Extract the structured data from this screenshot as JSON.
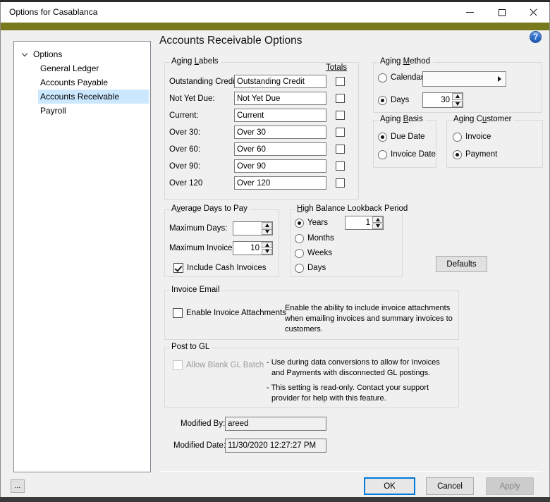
{
  "window": {
    "title": "Options for Casablanca"
  },
  "colors": {
    "accent_bar": "#79791e",
    "tree_selection": "#cce8ff",
    "default_button_border": "#0078d7",
    "help_blue": "#2e71d2"
  },
  "help_icon_glyph": "?",
  "sidebar": {
    "root": "Options",
    "items": [
      {
        "label": "General Ledger",
        "selected": false
      },
      {
        "label": "Accounts Payable",
        "selected": false
      },
      {
        "label": "Accounts Receivable",
        "selected": true
      },
      {
        "label": "Payroll",
        "selected": false
      }
    ]
  },
  "page": {
    "title": "Accounts Receivable Options"
  },
  "aging_labels": {
    "title": {
      "pre": "Aging ",
      "mn": "L",
      "post": "abels"
    },
    "totals_header": "Totals",
    "rows": [
      {
        "label": "Outstanding Credit:",
        "value": "Outstanding Credit",
        "totals_checked": false
      },
      {
        "label": "Not Yet Due:",
        "value": "Not Yet Due",
        "totals_checked": false
      },
      {
        "label": "Current:",
        "value": "Current",
        "totals_checked": false
      },
      {
        "label": "Over 30:",
        "value": "Over 30",
        "totals_checked": false
      },
      {
        "label": "Over 60:",
        "value": "Over 60",
        "totals_checked": false
      },
      {
        "label": "Over 90:",
        "value": "Over 90",
        "totals_checked": false
      },
      {
        "label": "Over 120",
        "value": "Over 120",
        "totals_checked": false
      }
    ]
  },
  "aging_method": {
    "title": {
      "pre": "Aging ",
      "mn": "M",
      "post": "ethod"
    },
    "calendar_label": "Calendar",
    "calendar_value": "",
    "days_label": "Days",
    "days_value": "30",
    "selected": "Days"
  },
  "aging_basis": {
    "title": {
      "pre": "Aging ",
      "mn": "B",
      "post": "asis"
    },
    "options": [
      "Due Date",
      "Invoice Date"
    ],
    "selected": "Due Date"
  },
  "aging_customer": {
    "title": {
      "pre": "Aging C",
      "mn": "u",
      "post": "stomer"
    },
    "options": [
      "Invoice",
      "Payment"
    ],
    "selected": "Payment"
  },
  "average_days": {
    "title": {
      "pre": "A",
      "mn": "v",
      "post": "erage Days to Pay"
    },
    "max_days_label": "Maximum Days:",
    "max_days_value": "",
    "max_invoices_label": "Maximum Invoices:",
    "max_invoices_value": "10",
    "include_cash_label": "Include Cash Invoices",
    "include_cash_checked": true
  },
  "lookback": {
    "title": {
      "pre": "",
      "mn": "H",
      "post": "igh Balance Lookback Period"
    },
    "options": [
      "Years",
      "Months",
      "Weeks",
      "Days"
    ],
    "selected": "Years",
    "value": "1"
  },
  "defaults_button_label": "Defaults",
  "invoice_email": {
    "title": "Invoice Email",
    "checkbox_label": "Enable Invoice Attachments",
    "checked": false,
    "description_lines": [
      "Enable the ability to include invoice attachments",
      "when emailing invoices and summary invoices to",
      "customers."
    ]
  },
  "post_to_gl": {
    "title": "Post to GL",
    "checkbox_label": "Allow Blank GL Batch",
    "checkbox_disabled": true,
    "note_lines": [
      "- Use during data conversions to allow for Invoices",
      "and Payments with disconnected GL postings.",
      "- This setting is read-only. Contact your support",
      "provider for help with this feature."
    ]
  },
  "modified": {
    "by_label": "Modified By:",
    "by_value": "areed",
    "date_label": "Modified Date:",
    "date_value": "11/30/2020 12:27:27 PM"
  },
  "footer": {
    "ok": "OK",
    "cancel": "Cancel",
    "apply": "Apply",
    "more": "..."
  }
}
